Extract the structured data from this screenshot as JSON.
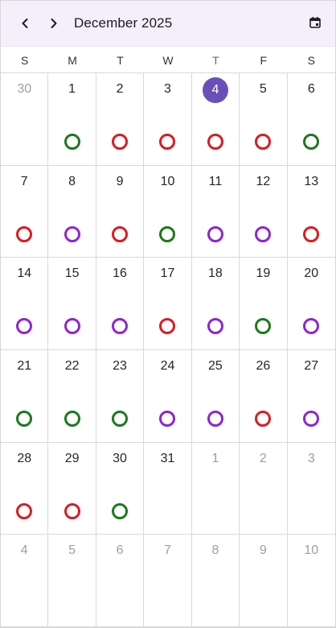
{
  "header": {
    "month_label": "December 2025",
    "prev_icon": "chevron-left-icon",
    "next_icon": "chevron-right-icon",
    "calendar_icon": "calendar-icon"
  },
  "weekdays": [
    "S",
    "M",
    "T",
    "W",
    "T",
    "F",
    "S"
  ],
  "today_weekday_index": 4,
  "colors": {
    "green": "#1a7a1a",
    "red": "#e0191f",
    "purple": "#8e24d6",
    "today_bg": "#6a4fb8",
    "header_bg": "#f4effb"
  },
  "days": [
    {
      "label": "30",
      "muted": true,
      "marker": null
    },
    {
      "label": "1",
      "muted": false,
      "marker": "green"
    },
    {
      "label": "2",
      "muted": false,
      "marker": "red"
    },
    {
      "label": "3",
      "muted": false,
      "marker": "red"
    },
    {
      "label": "4",
      "muted": false,
      "marker": "red",
      "today": true
    },
    {
      "label": "5",
      "muted": false,
      "marker": "red"
    },
    {
      "label": "6",
      "muted": false,
      "marker": "green"
    },
    {
      "label": "7",
      "muted": false,
      "marker": "red"
    },
    {
      "label": "8",
      "muted": false,
      "marker": "purple"
    },
    {
      "label": "9",
      "muted": false,
      "marker": "red"
    },
    {
      "label": "10",
      "muted": false,
      "marker": "green"
    },
    {
      "label": "11",
      "muted": false,
      "marker": "purple"
    },
    {
      "label": "12",
      "muted": false,
      "marker": "purple"
    },
    {
      "label": "13",
      "muted": false,
      "marker": "red"
    },
    {
      "label": "14",
      "muted": false,
      "marker": "purple"
    },
    {
      "label": "15",
      "muted": false,
      "marker": "purple"
    },
    {
      "label": "16",
      "muted": false,
      "marker": "purple"
    },
    {
      "label": "17",
      "muted": false,
      "marker": "red"
    },
    {
      "label": "18",
      "muted": false,
      "marker": "purple"
    },
    {
      "label": "19",
      "muted": false,
      "marker": "green"
    },
    {
      "label": "20",
      "muted": false,
      "marker": "purple"
    },
    {
      "label": "21",
      "muted": false,
      "marker": "green"
    },
    {
      "label": "22",
      "muted": false,
      "marker": "green"
    },
    {
      "label": "23",
      "muted": false,
      "marker": "green"
    },
    {
      "label": "24",
      "muted": false,
      "marker": "purple"
    },
    {
      "label": "25",
      "muted": false,
      "marker": "purple"
    },
    {
      "label": "26",
      "muted": false,
      "marker": "red"
    },
    {
      "label": "27",
      "muted": false,
      "marker": "purple"
    },
    {
      "label": "28",
      "muted": false,
      "marker": "red"
    },
    {
      "label": "29",
      "muted": false,
      "marker": "red"
    },
    {
      "label": "30",
      "muted": false,
      "marker": "green"
    },
    {
      "label": "31",
      "muted": false,
      "marker": null
    },
    {
      "label": "1",
      "muted": true,
      "marker": null
    },
    {
      "label": "2",
      "muted": true,
      "marker": null
    },
    {
      "label": "3",
      "muted": true,
      "marker": null
    },
    {
      "label": "4",
      "muted": true,
      "marker": null
    },
    {
      "label": "5",
      "muted": true,
      "marker": null
    },
    {
      "label": "6",
      "muted": true,
      "marker": null
    },
    {
      "label": "7",
      "muted": true,
      "marker": null
    },
    {
      "label": "8",
      "muted": true,
      "marker": null
    },
    {
      "label": "9",
      "muted": true,
      "marker": null
    },
    {
      "label": "10",
      "muted": true,
      "marker": null
    }
  ]
}
